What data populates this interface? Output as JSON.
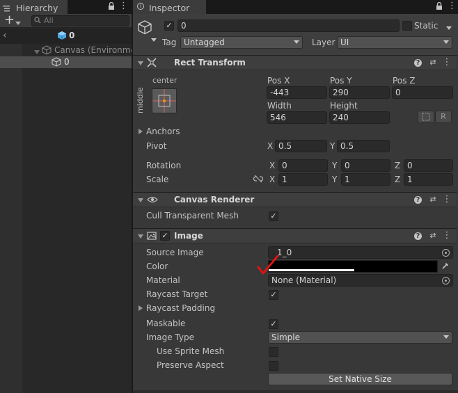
{
  "hierarchy": {
    "tab_label": "Hierarchy",
    "add_label": "+",
    "search_placeholder": "All",
    "scene_name": "0",
    "items": [
      {
        "label": "Canvas (Environme",
        "selected": false
      },
      {
        "label": "0",
        "selected": true
      }
    ]
  },
  "inspector": {
    "tab_label": "Inspector",
    "object_name": "0",
    "object_active": true,
    "static_label": "Static",
    "tag_label": "Tag",
    "tag_value": "Untagged",
    "layer_label": "Layer",
    "layer_value": "UI",
    "rect_transform": {
      "title": "Rect Transform",
      "anchor_preset_h": "center",
      "anchor_preset_v": "middle",
      "pos_x_label": "Pos X",
      "pos_x": "-443",
      "pos_y_label": "Pos Y",
      "pos_y": "290",
      "pos_z_label": "Pos Z",
      "pos_z": "0",
      "width_label": "Width",
      "width": "546",
      "height_label": "Height",
      "height": "240",
      "r_button": "R",
      "anchors_label": "Anchors",
      "pivot_label": "Pivot",
      "pivot_x": "0.5",
      "pivot_y": "0.5",
      "rotation_label": "Rotation",
      "rot_x": "0",
      "rot_y": "0",
      "rot_z": "0",
      "scale_label": "Scale",
      "scale_x": "1",
      "scale_y": "1",
      "scale_z": "1",
      "axis_x": "X",
      "axis_y": "Y",
      "axis_z": "Z"
    },
    "canvas_renderer": {
      "title": "Canvas Renderer",
      "cull_label": "Cull Transparent Mesh",
      "cull_checked": true
    },
    "image": {
      "title": "Image",
      "enabled": true,
      "source_image_label": "Source Image",
      "source_image_value": "1_0",
      "color_label": "Color",
      "color_value": "#000000",
      "material_label": "Material",
      "material_value": "None (Material)",
      "raycast_target_label": "Raycast Target",
      "raycast_target": true,
      "raycast_padding_label": "Raycast Padding",
      "maskable_label": "Maskable",
      "maskable": true,
      "image_type_label": "Image Type",
      "image_type_value": "Simple",
      "use_sprite_mesh_label": "Use Sprite Mesh",
      "preserve_aspect_label": "Preserve Aspect",
      "set_native_size_label": "Set Native Size"
    },
    "check_glyph": "✓",
    "help_glyph": "?",
    "settings_glyph": "⇄",
    "menu_glyph": "⋮"
  },
  "colors": {
    "panel": "#383838",
    "header": "#3e3e3e",
    "field": "#2a2a2a",
    "selected_row": "#4d4d4d",
    "red_mark": "#e01414"
  }
}
